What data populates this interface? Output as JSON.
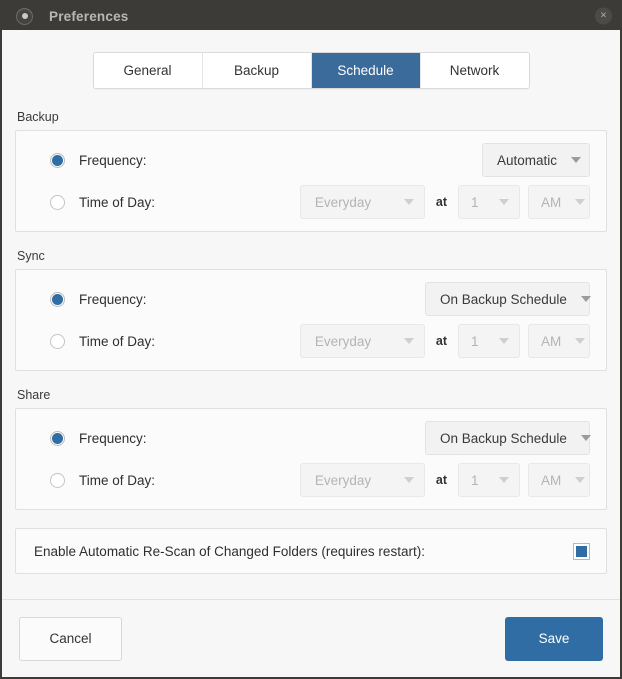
{
  "window": {
    "title": "Preferences",
    "app_icon": "circle-dot-icon",
    "close_label": "×"
  },
  "tabs": [
    {
      "label": "General",
      "active": false
    },
    {
      "label": "Backup",
      "active": false
    },
    {
      "label": "Schedule",
      "active": true
    },
    {
      "label": "Network",
      "active": false
    }
  ],
  "sections": [
    {
      "title": "Backup",
      "frequency_label": "Frequency:",
      "frequency_selected": true,
      "frequency_value": "Automatic",
      "time_label": "Time of Day:",
      "time_selected": false,
      "day_value": "Everyday",
      "at_label": "at",
      "hour_value": "1",
      "ampm_value": "AM"
    },
    {
      "title": "Sync",
      "frequency_label": "Frequency:",
      "frequency_selected": true,
      "frequency_value": "On Backup Schedule",
      "time_label": "Time of Day:",
      "time_selected": false,
      "day_value": "Everyday",
      "at_label": "at",
      "hour_value": "1",
      "ampm_value": "AM"
    },
    {
      "title": "Share",
      "frequency_label": "Frequency:",
      "frequency_selected": true,
      "frequency_value": "On Backup Schedule",
      "time_label": "Time of Day:",
      "time_selected": false,
      "day_value": "Everyday",
      "at_label": "at",
      "hour_value": "1",
      "ampm_value": "AM"
    }
  ],
  "rescan": {
    "label": "Enable Automatic Re-Scan of Changed Folders (requires restart):",
    "checked": true
  },
  "footer": {
    "cancel_label": "Cancel",
    "save_label": "Save"
  },
  "colors": {
    "accent": "#2f6da4",
    "tab_active": "#3a6b9a",
    "titlebar": "#3c3b37",
    "page_bg": "#f7f7f7",
    "panel_bg": "#fbfbfb"
  }
}
